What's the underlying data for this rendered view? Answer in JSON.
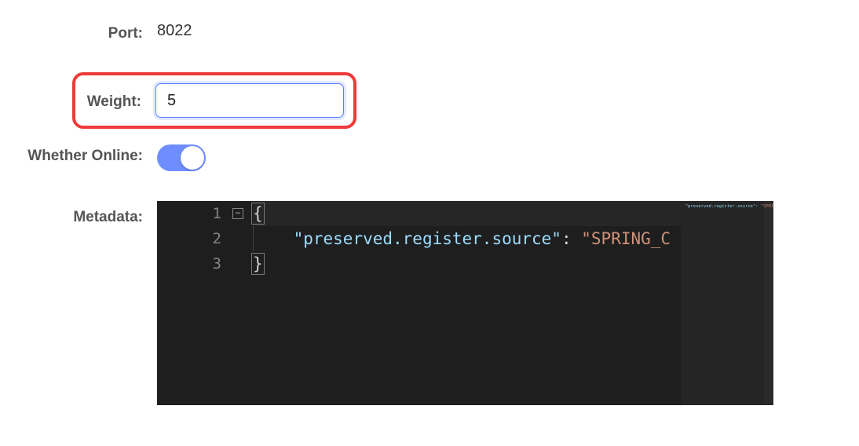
{
  "fields": {
    "port": {
      "label": "Port:",
      "value": "8022"
    },
    "weight": {
      "label": "Weight:",
      "value": "5"
    },
    "online": {
      "label": "Whether Online:",
      "on": true
    },
    "metadata": {
      "label": "Metadata:"
    }
  },
  "editor": {
    "lines": [
      {
        "num": "1",
        "open_brace": "{"
      },
      {
        "num": "2",
        "key": "\"preserved.register.source\"",
        "colon": ":",
        "value_partial": "\"SPRING_C"
      },
      {
        "num": "3",
        "close_brace": "}"
      }
    ],
    "fold_icon": "−",
    "minimap_key": "\"preserved.register.source\":",
    "minimap_val": "\"SPRING_"
  }
}
